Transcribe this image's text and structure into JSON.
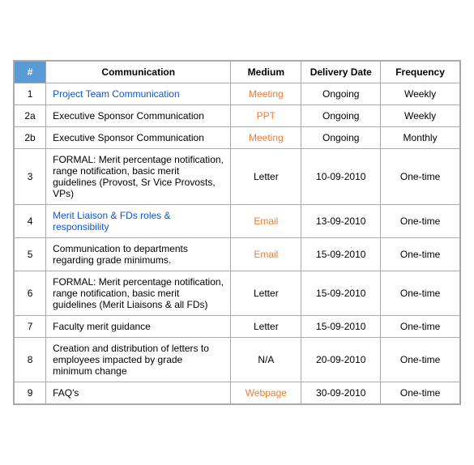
{
  "table": {
    "headers": {
      "hash": "#",
      "communication": "Communication",
      "medium": "Medium",
      "delivery_date": "Delivery Date",
      "frequency": "Frequency"
    },
    "rows": [
      {
        "num": "1",
        "communication": "Project Team Communication",
        "comm_is_link": true,
        "medium": "Meeting",
        "medium_class": "medium-meeting",
        "delivery_date": "Ongoing",
        "frequency": "Weekly"
      },
      {
        "num": "2a",
        "communication": "Executive Sponsor Communication",
        "comm_is_link": false,
        "medium": "PPT",
        "medium_class": "medium-ppt",
        "delivery_date": "Ongoing",
        "frequency": "Weekly"
      },
      {
        "num": "2b",
        "communication": "Executive Sponsor Communication",
        "comm_is_link": false,
        "medium": "Meeting",
        "medium_class": "medium-meeting",
        "delivery_date": "Ongoing",
        "frequency": "Monthly"
      },
      {
        "num": "3",
        "communication": "FORMAL: Merit percentage notification, range notification, basic merit guidelines (Provost, Sr Vice Provosts, VPs)",
        "comm_is_link": false,
        "medium": "Letter",
        "medium_class": "medium-letter",
        "delivery_date": "10-09-2010",
        "frequency": "One-time"
      },
      {
        "num": "4",
        "communication": "Merit Liaison & FDs roles & responsibility",
        "comm_is_link": true,
        "medium": "Email",
        "medium_class": "medium-email",
        "delivery_date": "13-09-2010",
        "frequency": "One-time"
      },
      {
        "num": "5",
        "communication": "Communication to departments regarding grade minimums.",
        "comm_is_link": false,
        "medium": "Email",
        "medium_class": "medium-email",
        "delivery_date": "15-09-2010",
        "frequency": "One-time"
      },
      {
        "num": "6",
        "communication": "FORMAL: Merit percentage notification, range notification, basic merit guidelines (Merit Liaisons & all FDs)",
        "comm_is_link": false,
        "medium": "Letter",
        "medium_class": "medium-letter",
        "delivery_date": "15-09-2010",
        "frequency": "One-time"
      },
      {
        "num": "7",
        "communication": "Faculty merit guidance",
        "comm_is_link": false,
        "medium": "Letter",
        "medium_class": "medium-letter",
        "delivery_date": "15-09-2010",
        "frequency": "One-time"
      },
      {
        "num": "8",
        "communication": "Creation and distribution of letters to employees impacted by grade minimum change",
        "comm_is_link": false,
        "medium": "N/A",
        "medium_class": "medium-na",
        "delivery_date": "20-09-2010",
        "frequency": "One-time"
      },
      {
        "num": "9",
        "communication": "FAQ's",
        "comm_is_link": false,
        "medium": "Webpage",
        "medium_class": "medium-webpage",
        "delivery_date": "30-09-2010",
        "frequency": "One-time"
      }
    ]
  }
}
